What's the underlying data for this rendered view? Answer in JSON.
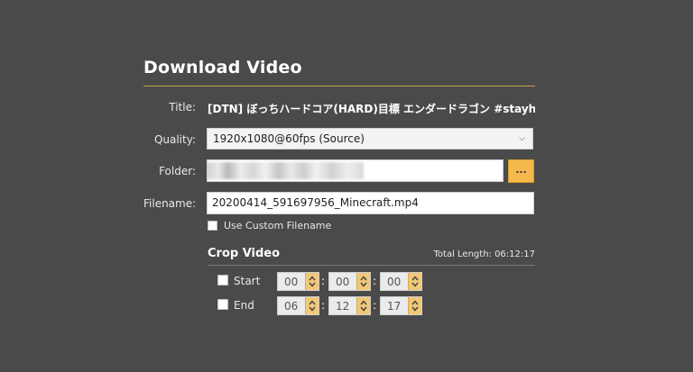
{
  "dialog": {
    "heading": "Download Video"
  },
  "title_row": {
    "label": "Title:",
    "value": "[DTN] ぼっちハードコア(HARD)目標 エンダードラゴン #stayhom..."
  },
  "quality_row": {
    "label": "Quality:",
    "selected": "1920x1080@60fps (Source)",
    "arrow_icon": "chevron-down-icon"
  },
  "folder_row": {
    "label": "Folder:",
    "value": "",
    "browse_label": "..."
  },
  "filename_row": {
    "label": "Filename:",
    "value": "20200414_591697956_Minecraft.mp4"
  },
  "custom_filename": {
    "label": "Use Custom Filename",
    "checked": false
  },
  "crop": {
    "title": "Crop Video",
    "total_length": "Total Length: 06:12:17",
    "start": {
      "label": "Start",
      "checked": false,
      "hours": "00",
      "minutes": "00",
      "seconds": "00"
    },
    "end": {
      "label": "End",
      "checked": false,
      "hours": "06",
      "minutes": "12",
      "seconds": "17"
    }
  },
  "colors": {
    "background": "#4a4a4a",
    "accent": "#f4b94d",
    "heading_rule": "#c9a24a"
  }
}
